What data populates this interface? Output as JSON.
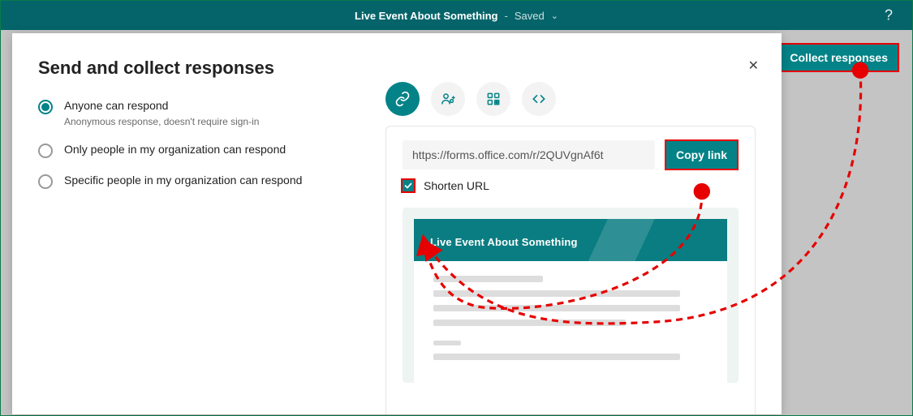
{
  "header": {
    "title": "Live Event About Something",
    "saved": "Saved"
  },
  "collect_btn": "Collect responses",
  "dialog": {
    "title": "Send and collect responses",
    "options": [
      {
        "title": "Anyone can respond",
        "sub": "Anonymous response, doesn't require sign-in"
      },
      {
        "title": "Only people in my organization can respond"
      },
      {
        "title": "Specific people in my organization can respond"
      }
    ],
    "url": "https://forms.office.com/r/2QUVgnAf6t",
    "copy": "Copy link",
    "shorten": "Shorten URL",
    "preview_title": "Live Event About Something"
  }
}
